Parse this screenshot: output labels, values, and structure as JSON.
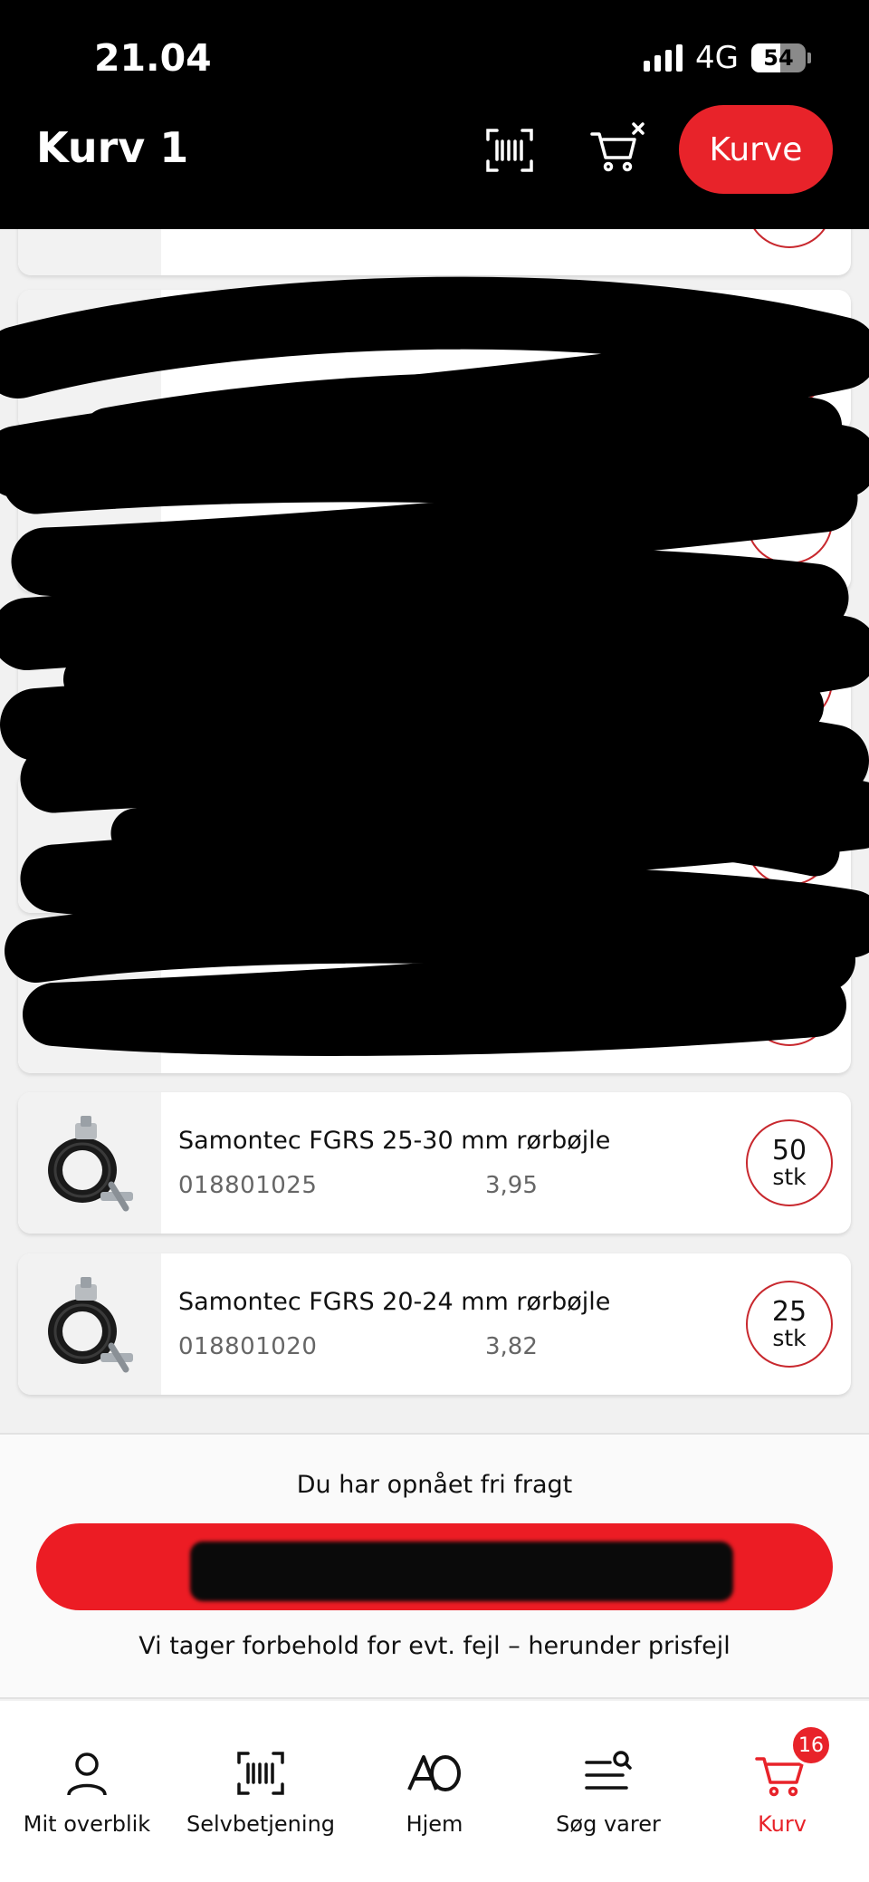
{
  "status_bar": {
    "time": "21.04",
    "network": "4G",
    "battery": "54",
    "battery_level": 0.54
  },
  "header": {
    "title": "Kurv 1",
    "kurve_button": "Kurve",
    "scan_icon": "barcode-scan-icon",
    "clear_cart_icon": "cart-clear-icon"
  },
  "items": [
    {
      "name": "",
      "sku": "",
      "price": "",
      "qty": "",
      "unit": ""
    },
    {
      "name": "",
      "sku": "",
      "price": "",
      "qty": "",
      "unit": ""
    },
    {
      "name": "",
      "sku": "",
      "price": "",
      "qty": "",
      "unit": ""
    },
    {
      "name": "",
      "sku": "",
      "price": "",
      "qty": "",
      "unit": ""
    },
    {
      "name": "",
      "sku": "",
      "price": "",
      "qty": "",
      "unit": ""
    },
    {
      "name": "",
      "sku": "",
      "price": "",
      "qty": "",
      "unit": ""
    },
    {
      "name": "Samontec FGRS 25-30 mm rørbøjle",
      "sku": "018801025",
      "price": "3,95",
      "qty": "50",
      "unit": "stk"
    },
    {
      "name": "Samontec FGRS 20-24 mm rørbøjle",
      "sku": "018801020",
      "price": "3,82",
      "qty": "25",
      "unit": "stk"
    }
  ],
  "summary": {
    "freight_text": "Du har opnået fri fragt",
    "checkout_total": "",
    "disclaimer": "Vi tager forbehold for evt. fejl – herunder prisfejl"
  },
  "tabbar": {
    "tabs": [
      {
        "label": "Mit overblik",
        "icon": "person-icon"
      },
      {
        "label": "Selvbetjening",
        "icon": "barcode-icon"
      },
      {
        "label": "Hjem",
        "icon": "ao-logo-icon"
      },
      {
        "label": "Søg varer",
        "icon": "search-list-icon"
      },
      {
        "label": "Kurv",
        "icon": "cart-icon"
      }
    ],
    "cart_badge": "16"
  },
  "colors": {
    "brand_red": "#e8232a",
    "header_bg": "#000000",
    "qty_ring": "#c8282e"
  }
}
